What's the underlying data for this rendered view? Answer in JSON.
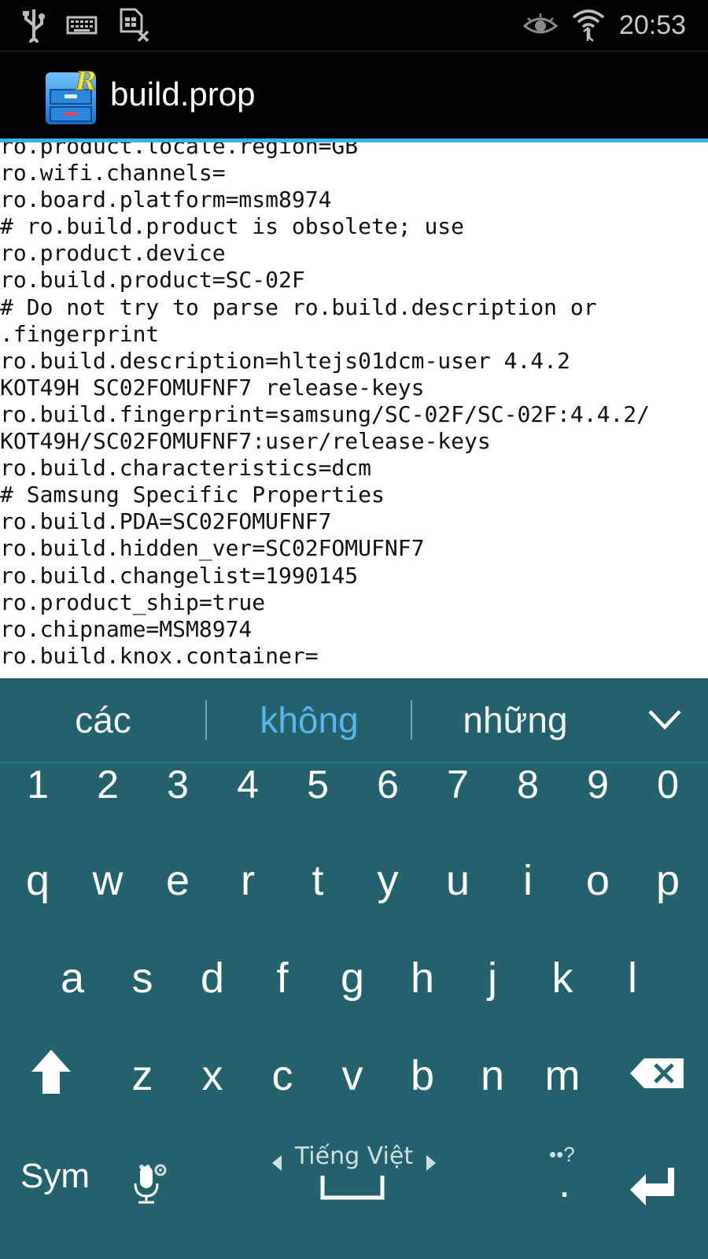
{
  "status_bar": {
    "time": "20:53",
    "left_icons": [
      "usb-icon",
      "keyboard-icon",
      "sim-card-off-icon"
    ],
    "right_icons": [
      "eye-icon",
      "wifi-icon"
    ]
  },
  "action_bar": {
    "title": "build.prop",
    "icon": "root-explorer-icon"
  },
  "editor": {
    "lines": [
      "ro.product.locale.region=GB",
      "ro.wifi.channels=",
      "ro.board.platform=msm8974",
      "# ro.build.product is obsolete; use",
      "ro.product.device",
      "ro.build.product=SC-02F",
      "# Do not try to parse ro.build.description or",
      ".fingerprint",
      "ro.build.description=hltejs01dcm-user 4.4.2",
      "KOT49H SC02FOMUFNF7 release-keys",
      "ro.build.fingerprint=samsung/SC-02F/SC-02F:4.4.2/",
      "KOT49H/SC02FOMUFNF7:user/release-keys",
      "ro.build.characteristics=dcm",
      "# Samsung Specific Properties",
      "ro.build.PDA=SC02FOMUFNF7",
      "ro.build.hidden_ver=SC02FOMUFNF7",
      "ro.build.changelist=1990145",
      "ro.product_ship=true",
      "ro.chipname=MSM8974",
      "ro.build.knox.container="
    ]
  },
  "keyboard": {
    "suggestions": [
      "các",
      "không",
      "những"
    ],
    "number_row": [
      "1",
      "2",
      "3",
      "4",
      "5",
      "6",
      "7",
      "8",
      "9",
      "0"
    ],
    "row1": [
      "q",
      "w",
      "e",
      "r",
      "t",
      "y",
      "u",
      "i",
      "o",
      "p"
    ],
    "row2": [
      "a",
      "s",
      "d",
      "f",
      "g",
      "h",
      "j",
      "k",
      "l"
    ],
    "row3": [
      "z",
      "x",
      "c",
      "v",
      "b",
      "n",
      "m"
    ],
    "sym_label": "Sym",
    "language_label": "Tiếng Việt",
    "period_label": ".",
    "period_hint": "••?",
    "accent_color": "#5ab5ea",
    "background_color": "#23616d"
  }
}
